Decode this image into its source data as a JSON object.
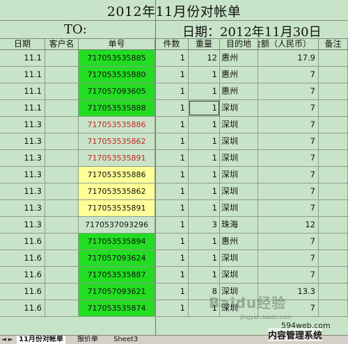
{
  "sheet": {
    "title": "2012年11月份对帐单",
    "to_label": "TO:",
    "date_label": "日期：2012年11月30日",
    "headers": {
      "date": "日期",
      "customer": "客户名",
      "number": "单号",
      "count": "件数",
      "weight": "重量",
      "destination": "目的地",
      "amount": "金额（人民币）",
      "note": "备注"
    },
    "rows": [
      {
        "date": "11.1",
        "customer": "",
        "number": "717053535885",
        "count": "1",
        "weight": "12",
        "destination": "惠州",
        "amount": "17.9",
        "note": ""
      },
      {
        "date": "11.1",
        "customer": "",
        "number": "717053535880",
        "count": "1",
        "weight": "1",
        "destination": "惠州",
        "amount": "7",
        "note": ""
      },
      {
        "date": "11.1",
        "customer": "",
        "number": "717057093605",
        "count": "1",
        "weight": "1",
        "destination": "惠州",
        "amount": "7",
        "note": ""
      },
      {
        "date": "11.1",
        "customer": "",
        "number": "717053535888",
        "count": "1",
        "weight": "1",
        "destination": "深圳",
        "amount": "7",
        "note": ""
      },
      {
        "date": "11.3",
        "customer": "",
        "number": "717053535886",
        "count": "1",
        "weight": "1",
        "destination": "深圳",
        "amount": "7",
        "note": ""
      },
      {
        "date": "11.3",
        "customer": "",
        "number": "717053535862",
        "count": "1",
        "weight": "1",
        "destination": "深圳",
        "amount": "7",
        "note": ""
      },
      {
        "date": "11.3",
        "customer": "",
        "number": "717053535891",
        "count": "1",
        "weight": "1",
        "destination": "深圳",
        "amount": "7",
        "note": ""
      },
      {
        "date": "11.3",
        "customer": "",
        "number": "717053535886",
        "count": "1",
        "weight": "1",
        "destination": "深圳",
        "amount": "7",
        "note": ""
      },
      {
        "date": "11.3",
        "customer": "",
        "number": "717053535862",
        "count": "1",
        "weight": "1",
        "destination": "深圳",
        "amount": "7",
        "note": ""
      },
      {
        "date": "11.3",
        "customer": "",
        "number": "717053535891",
        "count": "1",
        "weight": "1",
        "destination": "深圳",
        "amount": "7",
        "note": ""
      },
      {
        "date": "11.3",
        "customer": "",
        "number": "7170537093296",
        "count": "1",
        "weight": "3",
        "destination": "珠海",
        "amount": "12",
        "note": ""
      },
      {
        "date": "11.6",
        "customer": "",
        "number": "717053535894",
        "count": "1",
        "weight": "1",
        "destination": "惠州",
        "amount": "7",
        "note": ""
      },
      {
        "date": "11.6",
        "customer": "",
        "number": "717057093624",
        "count": "1",
        "weight": "1",
        "destination": "深圳",
        "amount": "7",
        "note": ""
      },
      {
        "date": "11.6",
        "customer": "",
        "number": "717053535887",
        "count": "1",
        "weight": "1",
        "destination": "深圳",
        "amount": "7",
        "note": ""
      },
      {
        "date": "11.6",
        "customer": "",
        "number": "717057093621",
        "count": "1",
        "weight": "8",
        "destination": "深圳",
        "amount": "13.3",
        "note": ""
      },
      {
        "date": "11.6",
        "customer": "",
        "number": "717053535874",
        "count": "1",
        "weight": "1",
        "destination": "深圳",
        "amount": "7",
        "note": ""
      }
    ]
  },
  "row_styles": [
    "green",
    "green",
    "green",
    "green",
    "red",
    "red",
    "red",
    "yellow",
    "yellow",
    "yellow",
    "plain",
    "green",
    "green",
    "green",
    "green",
    "green"
  ],
  "colors": {
    "sheet_bg": "#c8e4c8",
    "green_fill": "#22dd22",
    "yellow_fill": "#ffff99",
    "red_text": "#cc2222"
  },
  "tabs": [
    "11月份对帐单",
    "报价单",
    "Sheet3"
  ],
  "tab_nav": "◄ ►",
  "watermark": {
    "site": "594web.com",
    "cms": "内容管理系统",
    "logo": "Baidu经验",
    "sub": "jingyan.baidu.com"
  }
}
